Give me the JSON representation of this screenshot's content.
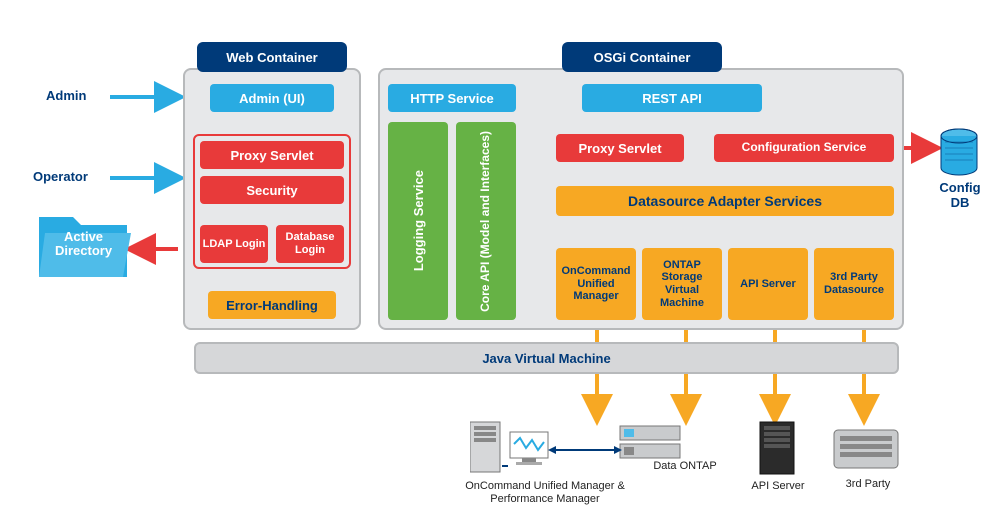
{
  "left": {
    "admin": "Admin",
    "operator": "Operator",
    "active_directory_l1": "Active",
    "active_directory_l2": "Directory"
  },
  "web": {
    "title": "Web Container",
    "admin_ui": "Admin (UI)",
    "proxy_servlet": "Proxy Servlet",
    "security": "Security",
    "ldap": "LDAP Login",
    "db_login": "Database Login",
    "error": "Error-Handling"
  },
  "osgi": {
    "title": "OSGi Container",
    "http": "HTTP Service",
    "rest": "REST API",
    "proxy": "Proxy Servlet",
    "config_service": "Configuration Service",
    "logging": "Logging Service",
    "core_api": "Core API (Model and Interfaces)",
    "ds_adapter": "Datasource Adapter Services",
    "ds": {
      "oncommand": "OnCommand Unified Manager",
      "ontap": "ONTAP Storage Virtual Machine",
      "api": "API Server",
      "third": "3rd Party Datasource"
    }
  },
  "right": {
    "config_db_l1": "Config",
    "config_db_l2": "DB"
  },
  "jvm": "Java Virtual Machine",
  "bottom": {
    "ocum": "OnCommand Unified Manager & Performance Manager",
    "ontap": "Data ONTAP",
    "api": "API Server",
    "third": "3rd Party"
  }
}
